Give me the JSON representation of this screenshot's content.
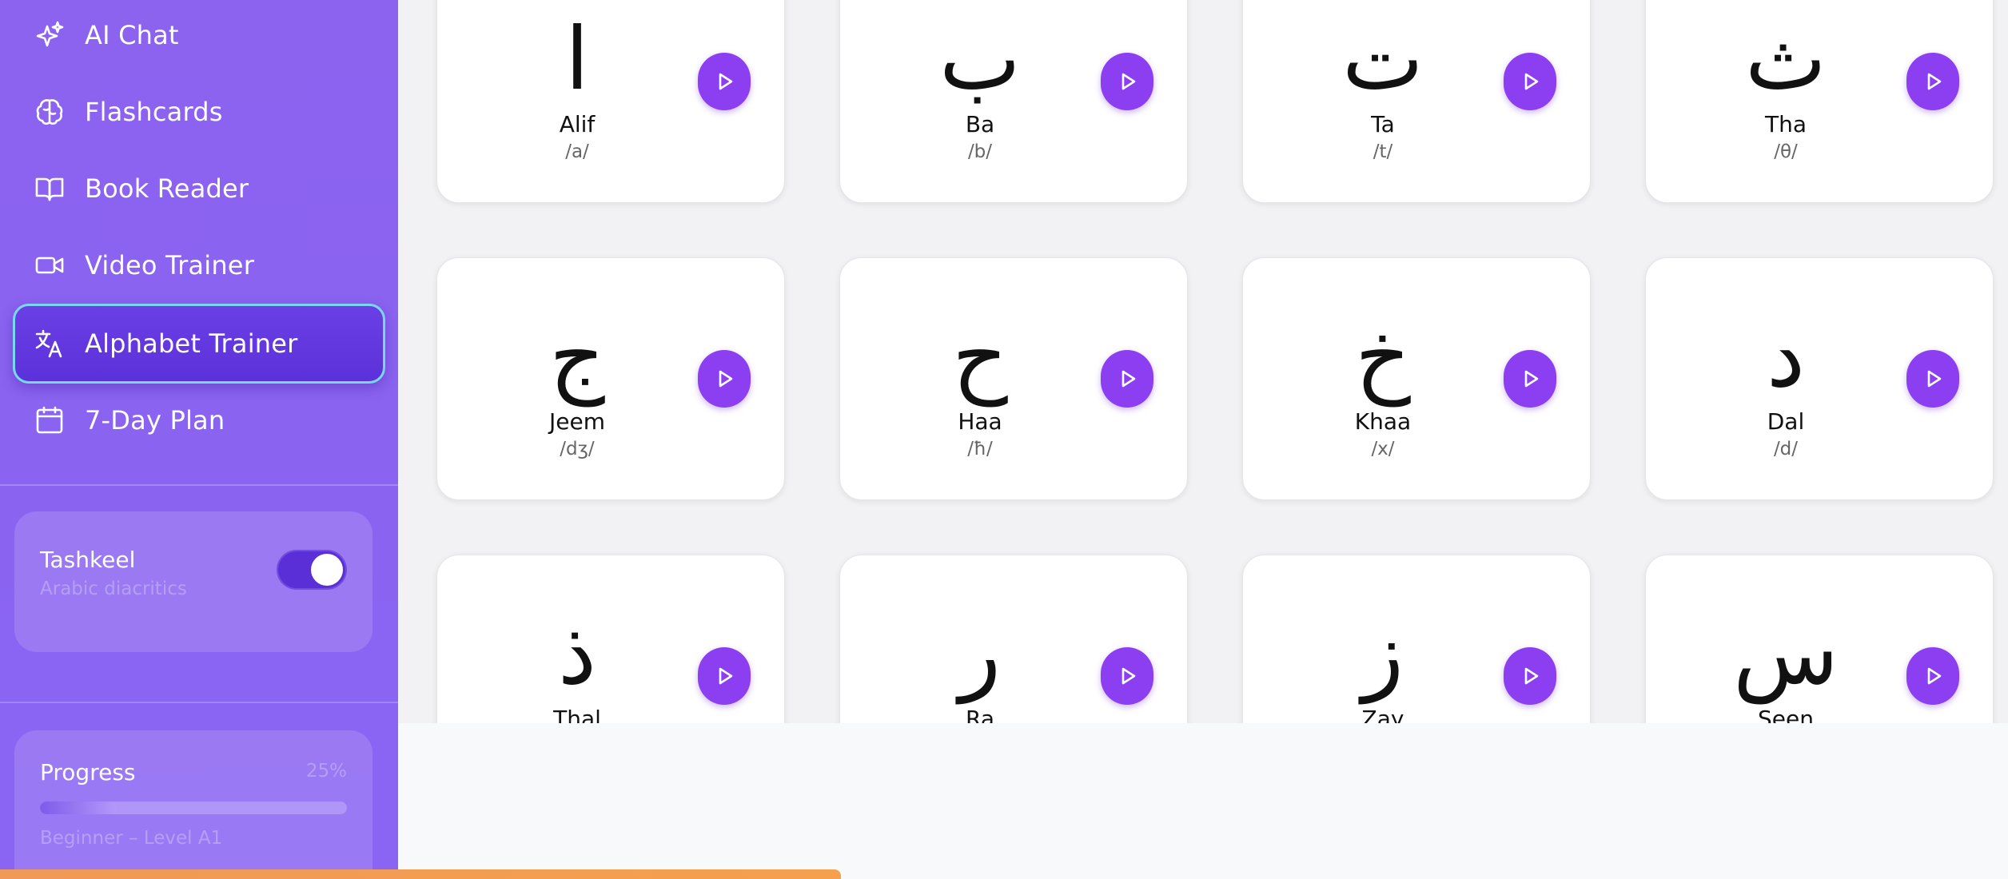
{
  "sidebar": {
    "items": [
      {
        "label": "AI Chat",
        "icon": "sparkle-icon"
      },
      {
        "label": "Flashcards",
        "icon": "brain-icon"
      },
      {
        "label": "Book Reader",
        "icon": "book-open-icon"
      },
      {
        "label": "Video Trainer",
        "icon": "video-camera-icon"
      },
      {
        "label": "Alphabet Trainer",
        "icon": "translate-icon",
        "active": true
      },
      {
        "label": "7-Day Plan",
        "icon": "calendar-icon"
      }
    ],
    "tashkeel": {
      "title": "Tashkeel",
      "subtitle": "Arabic diacritics",
      "enabled": true
    },
    "progress": {
      "title": "Progress",
      "percent_label": "25%",
      "percent": 25,
      "level": "Beginner – Level A1"
    }
  },
  "letters": [
    {
      "char": "ا",
      "name": "Alif",
      "ipa": "/a/"
    },
    {
      "char": "ب",
      "name": "Ba",
      "ipa": "/b/"
    },
    {
      "char": "ت",
      "name": "Ta",
      "ipa": "/t/"
    },
    {
      "char": "ث",
      "name": "Tha",
      "ipa": "/θ/"
    },
    {
      "char": "ج",
      "name": "Jeem",
      "ipa": "/dʒ/"
    },
    {
      "char": "ح",
      "name": "Haa",
      "ipa": "/ħ/"
    },
    {
      "char": "خ",
      "name": "Khaa",
      "ipa": "/x/"
    },
    {
      "char": "د",
      "name": "Dal",
      "ipa": "/d/"
    },
    {
      "char": "ذ",
      "name": "Thal",
      "ipa": ""
    },
    {
      "char": "ر",
      "name": "Ra",
      "ipa": ""
    },
    {
      "char": "ز",
      "name": "Zay",
      "ipa": ""
    },
    {
      "char": "س",
      "name": "Seen",
      "ipa": ""
    }
  ],
  "colors": {
    "accent": "#8b3ff0",
    "sidebar": "#8b63ef",
    "active_nav": "#5c31d9"
  }
}
